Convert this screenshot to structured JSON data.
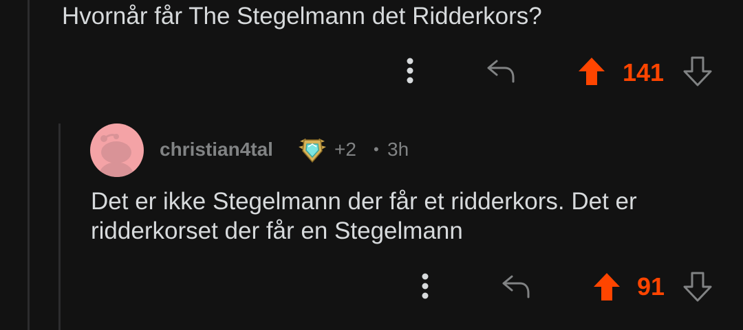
{
  "parent_comment": {
    "body": "Hvornår får The Stegelmann det Ridderkors?",
    "score": "141"
  },
  "reply_comment": {
    "username": "christian4tal",
    "award_count": "+2",
    "separator": "•",
    "time_ago": "3h",
    "body_lines": [
      "Det er ikke Stegelmann der får et ridderkors. Det er",
      "ridderkorset der får en Stegelmann"
    ],
    "score": "91"
  },
  "icons": {
    "more": "more-vertical-icon",
    "reply": "reply-arrow-icon",
    "upvote": "upvote-arrow-icon",
    "downvote": "downvote-arrow-icon",
    "award": "gold-award-icon",
    "avatar": "snoo-avatar"
  },
  "colors": {
    "background": "#121212",
    "text": "#d7dadc",
    "meta": "#818384",
    "upvoted": "#ff4500",
    "avatar_bg": "#f4a3a6",
    "thread_line": "#2c2c2e"
  }
}
